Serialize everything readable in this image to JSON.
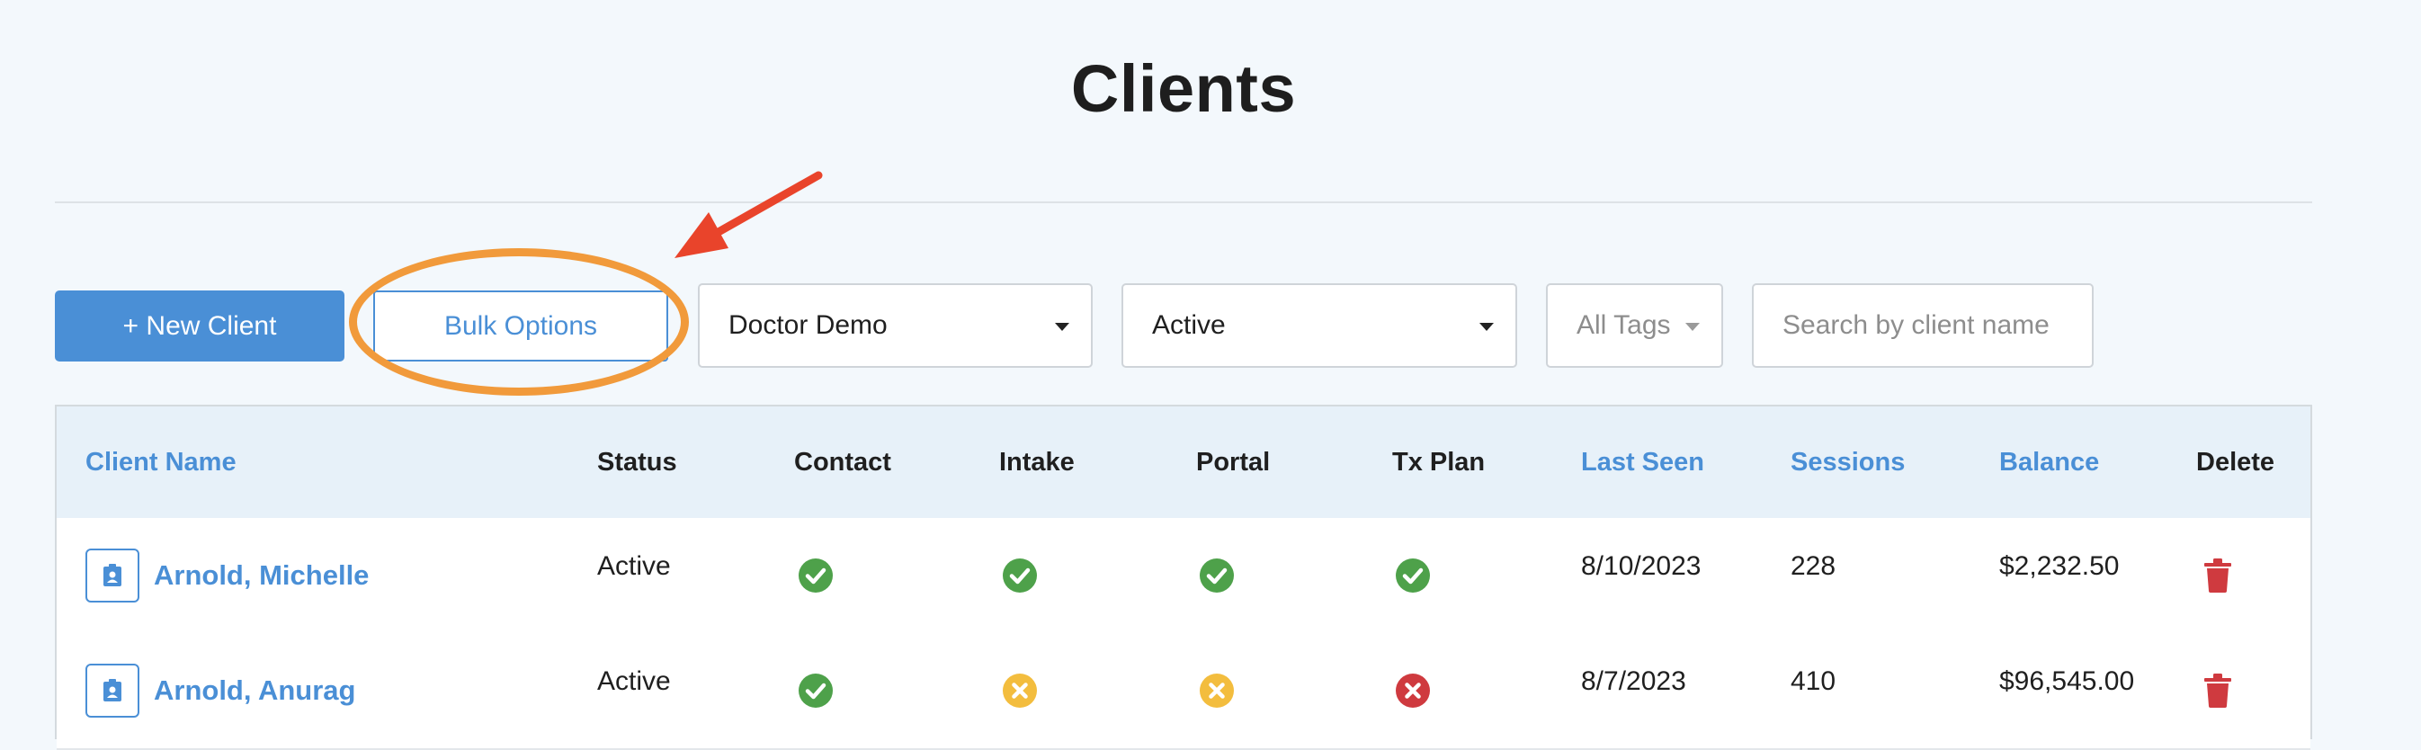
{
  "page": {
    "title": "Clients"
  },
  "toolbar": {
    "new_client_label": "+ New Client",
    "bulk_options_label": "Bulk Options",
    "doctor_select": "Doctor Demo",
    "status_select": "Active",
    "tags_select": "All Tags",
    "search_placeholder": "Search by client name"
  },
  "annotation": {
    "arrow_color": "#e9442b",
    "ellipse_color": "#f19a3b"
  },
  "colors": {
    "accent": "#4a8fd6",
    "ok": "#4ea14a",
    "warn": "#f3bd3e",
    "error": "#cf3a3f",
    "delete": "#cf3a3f"
  },
  "table": {
    "headers": {
      "client_name": "Client Name",
      "status": "Status",
      "contact": "Contact",
      "intake": "Intake",
      "portal": "Portal",
      "tx_plan": "Tx Plan",
      "last_seen": "Last Seen",
      "sessions": "Sessions",
      "balance": "Balance",
      "delete": "Delete"
    },
    "rows": [
      {
        "name": "Arnold, Michelle",
        "status": "Active",
        "contact": "check-icon",
        "intake": "check-icon",
        "portal": "check-icon",
        "tx_plan": "check-icon",
        "last_seen": "8/10/2023",
        "sessions": "228",
        "balance": "$2,232.50"
      },
      {
        "name": "Arnold, Anurag",
        "status": "Active",
        "contact": "check-icon",
        "intake": "warning-x-icon",
        "portal": "warning-x-icon",
        "tx_plan": "error-x-icon",
        "last_seen": "8/7/2023",
        "sessions": "410",
        "balance": "$96,545.00"
      }
    ]
  }
}
